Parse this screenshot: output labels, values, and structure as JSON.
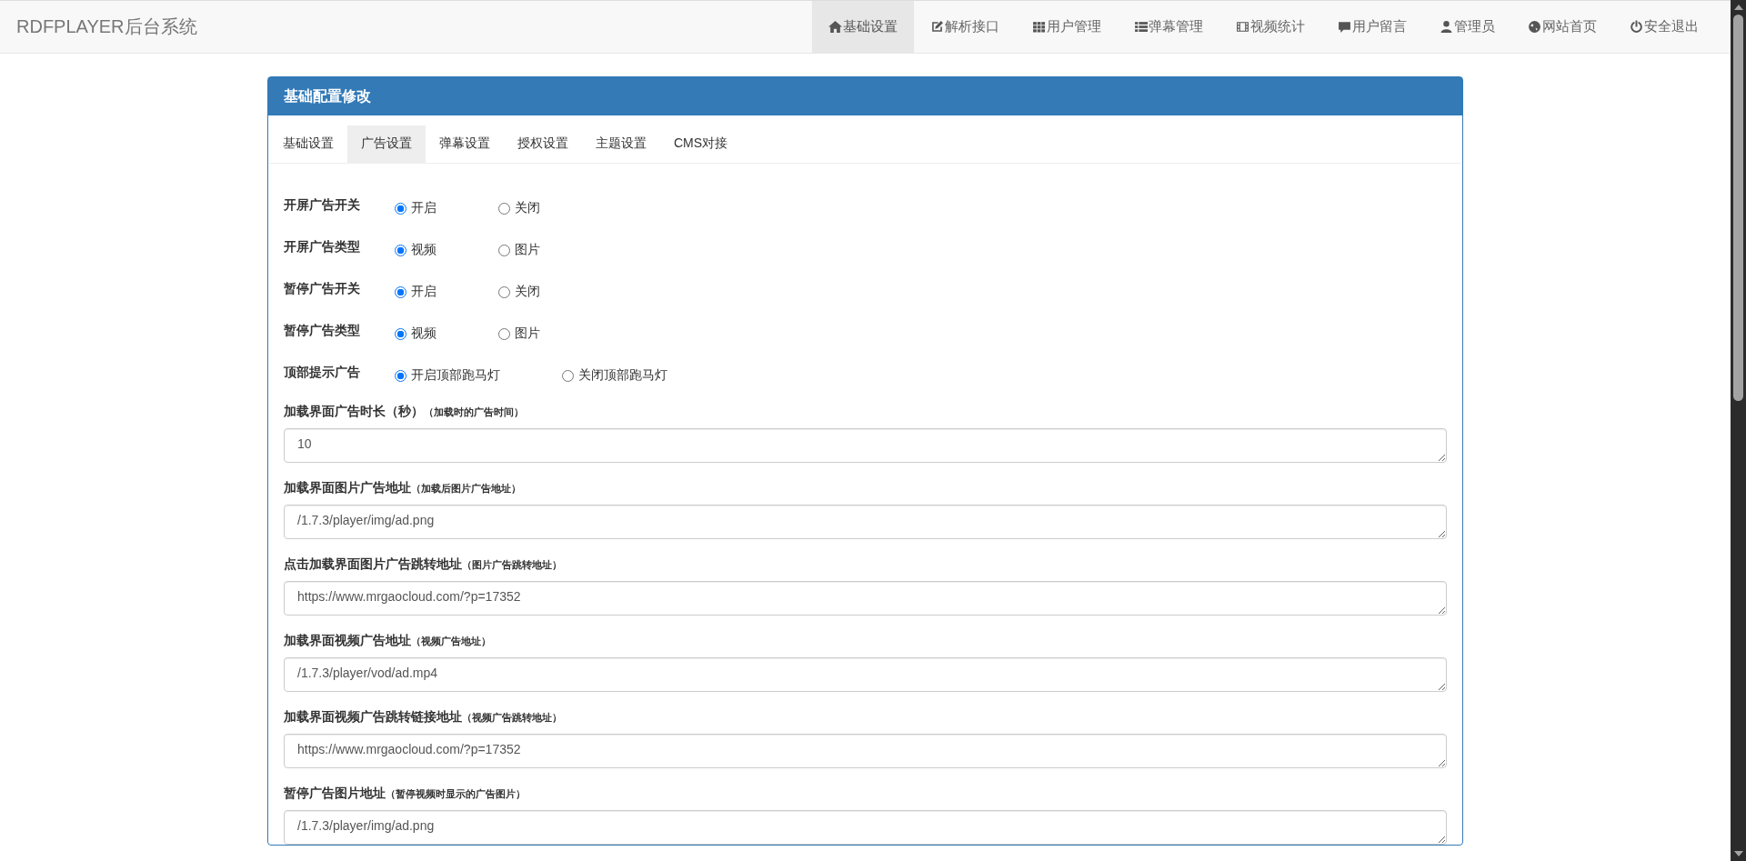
{
  "brand": "RDFPLAYER后台系统",
  "nav": [
    {
      "label": "基础设置",
      "kind": "home",
      "selected": true
    },
    {
      "label": "解析接口",
      "kind": "edit",
      "selected": false
    },
    {
      "label": "用户管理",
      "kind": "grid",
      "selected": false
    },
    {
      "label": "弹幕管理",
      "kind": "list",
      "selected": false
    },
    {
      "label": "视频统计",
      "kind": "film",
      "selected": false
    },
    {
      "label": "用户留言",
      "kind": "comment",
      "selected": false
    },
    {
      "label": "管理员",
      "kind": "user",
      "selected": false
    },
    {
      "label": "网站首页",
      "kind": "globe",
      "selected": false
    },
    {
      "label": "安全退出",
      "kind": "power",
      "selected": false
    }
  ],
  "panel": {
    "title": "基础配置修改",
    "tabs": [
      {
        "label": "基础设置",
        "selected": false
      },
      {
        "label": "广告设置",
        "selected": true
      },
      {
        "label": "弹幕设置",
        "selected": false
      },
      {
        "label": "授权设置",
        "selected": false
      },
      {
        "label": "主题设置",
        "selected": false
      },
      {
        "label": "CMS对接",
        "selected": false
      }
    ],
    "radio_groups": [
      {
        "label": "开屏广告开关",
        "options": [
          {
            "label": "开启",
            "selected": true
          },
          {
            "label": "关闭",
            "selected": false
          }
        ]
      },
      {
        "label": "开屏广告类型",
        "options": [
          {
            "label": "视频",
            "selected": true
          },
          {
            "label": "图片",
            "selected": false
          }
        ]
      },
      {
        "label": "暂停广告开关",
        "options": [
          {
            "label": "开启",
            "selected": true
          },
          {
            "label": "关闭",
            "selected": false
          }
        ]
      },
      {
        "label": "暂停广告类型",
        "options": [
          {
            "label": "视频",
            "selected": true
          },
          {
            "label": "图片",
            "selected": false
          }
        ]
      },
      {
        "label": "顶部提示广告",
        "options": [
          {
            "label": "开启顶部跑马灯",
            "selected": true
          },
          {
            "label": "关闭顶部跑马灯",
            "selected": false
          }
        ]
      }
    ],
    "fields": [
      {
        "label": "加载界面广告时长（秒）",
        "note": "（加载时的广告时间）",
        "value": "10"
      },
      {
        "label": "加载界面图片广告地址",
        "note": "（加载后图片广告地址）",
        "value": "/1.7.3/player/img/ad.png"
      },
      {
        "label": "点击加载界面图片广告跳转地址",
        "note": "（图片广告跳转地址）",
        "value": "https://www.mrgaocloud.com/?p=17352"
      },
      {
        "label": "加载界面视频广告地址",
        "note": "（视频广告地址）",
        "value": "/1.7.3/player/vod/ad.mp4"
      },
      {
        "label": "加载界面视频广告跳转链接地址",
        "note": "（视频广告跳转地址）",
        "value": "https://www.mrgaocloud.com/?p=17352"
      },
      {
        "label": "暂停广告图片地址",
        "note": "（暂停视频时显示的广告图片）",
        "value": "/1.7.3/player/img/ad.png"
      }
    ]
  }
}
